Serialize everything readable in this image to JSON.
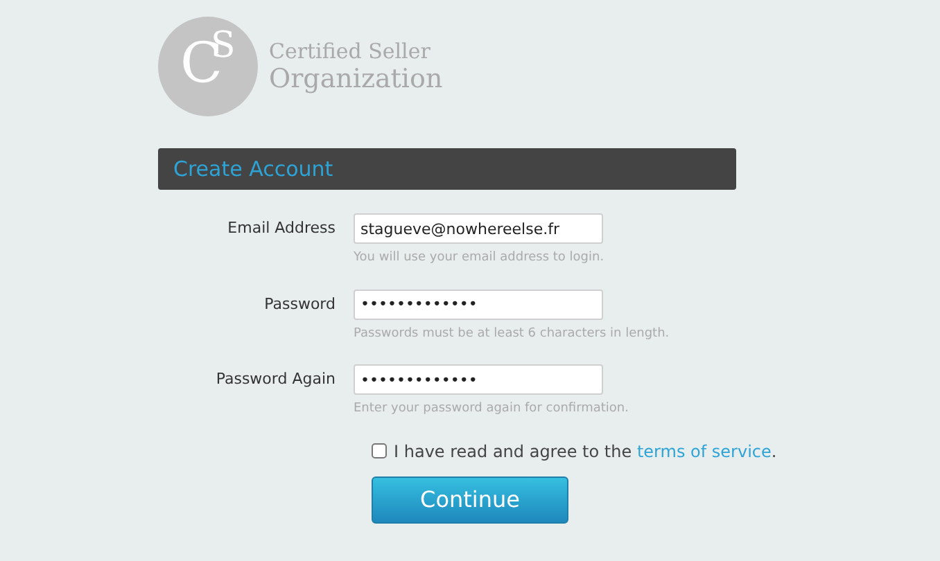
{
  "logo": {
    "letters": [
      "C",
      "S"
    ],
    "line_1": "Certified Seller",
    "line_2": "Organization"
  },
  "header": {
    "title": "Create Account"
  },
  "fields": [
    {
      "label": "Email Address",
      "value": "stagueve@nowhereelse.fr",
      "hint": "You will use your email address to login."
    },
    {
      "label": "Password",
      "value": "•••••••••••••",
      "hint": "Passwords must be at least 6 characters in length."
    },
    {
      "label": "Password Again",
      "value": "•••••••••••••",
      "hint": "Enter your password again for confirmation."
    }
  ],
  "agreement": {
    "checked": false,
    "text": "I have read and agree to the",
    "link": "terms of service",
    "end": "."
  },
  "button": "Continue"
}
